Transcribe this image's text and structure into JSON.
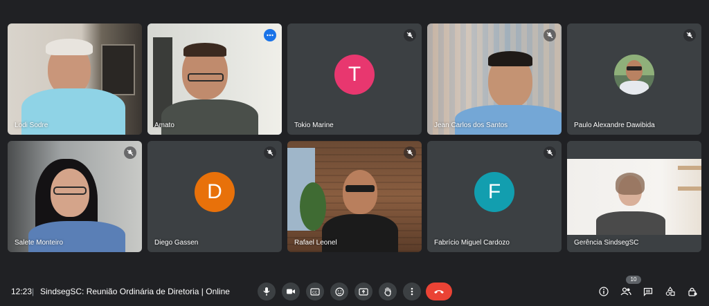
{
  "participants": [
    {
      "name": "Lodi Sodre",
      "muted": false,
      "kind": "video"
    },
    {
      "name": "Amato",
      "muted": false,
      "kind": "video",
      "active": true
    },
    {
      "name": "Tokio Marine",
      "muted": true,
      "kind": "initial",
      "initial": "T",
      "color": "#e8376f"
    },
    {
      "name": "Jean Carlos dos Santos",
      "muted": true,
      "kind": "video"
    },
    {
      "name": "Paulo Alexandre Dawibida",
      "muted": true,
      "kind": "photo-avatar"
    },
    {
      "name": "Salete Monteiro",
      "muted": true,
      "kind": "video"
    },
    {
      "name": "Diego Gassen",
      "muted": true,
      "kind": "initial",
      "initial": "D",
      "color": "#e8710a"
    },
    {
      "name": "Rafael Leonel",
      "muted": true,
      "kind": "video"
    },
    {
      "name": "Fabrício Miguel Cardozo",
      "muted": true,
      "kind": "initial",
      "initial": "F",
      "color": "#129eaf"
    },
    {
      "name": "Gerência SindsegSC",
      "muted": false,
      "kind": "video"
    }
  ],
  "bottom_bar": {
    "time": "12:23",
    "separator": "|",
    "meeting_title": "SindsegSC: Reunião Ordinária de Diretoria | Online",
    "participant_count": "10"
  },
  "colors": {
    "background": "#202124",
    "tile": "#3c4043",
    "end_call": "#ea4335",
    "active_border": "#8ab4f8"
  }
}
